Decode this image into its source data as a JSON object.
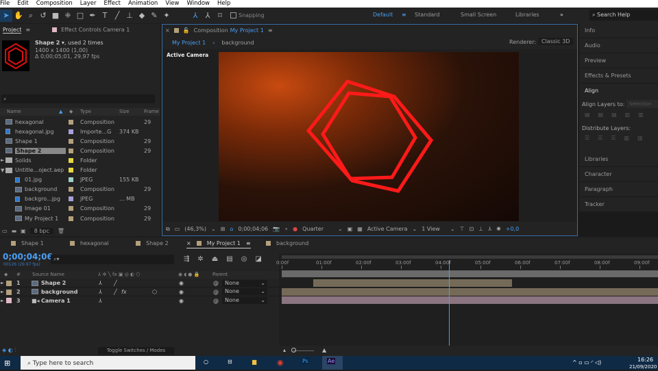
{
  "menu": [
    "File",
    "Edit",
    "Composition",
    "Layer",
    "Effect",
    "Animation",
    "View",
    "Window",
    "Help"
  ],
  "toolbar": {
    "snapping": "Snapping",
    "workspaces": [
      "Default",
      "Standard",
      "Small Screen",
      "Libraries"
    ],
    "active_workspace": "Default",
    "search_help": "Search Help"
  },
  "project": {
    "tab": "Project",
    "effect_controls_tab": "Effect Controls Camera 1",
    "selected_name": "Shape 2",
    "used": ", used 2 times",
    "dims": "1400 x 1400 (1,00)",
    "duration": "Δ 0;00;05;01, 29,97 fps",
    "search_placeholder": "",
    "columns": [
      "Name",
      "Type",
      "Size",
      "Frame"
    ],
    "items": [
      {
        "name": "hexagonal",
        "type": "Composition",
        "size": "",
        "frame": "29",
        "color": "#b4a07c",
        "indent": 0,
        "kind": "comp"
      },
      {
        "name": "hexagonal.jpg",
        "type": "Importe...G",
        "size": "374 KB",
        "frame": "",
        "color": "#a8a0d8",
        "indent": 0,
        "kind": "img"
      },
      {
        "name": "Shape 1",
        "type": "Composition",
        "size": "",
        "frame": "29",
        "color": "#b4a07c",
        "indent": 0,
        "kind": "comp"
      },
      {
        "name": "Shape 2",
        "type": "Composition",
        "size": "",
        "frame": "29",
        "color": "#b4a07c",
        "indent": 0,
        "kind": "comp",
        "selected": true
      },
      {
        "name": "Solids",
        "type": "Folder",
        "size": "",
        "frame": "",
        "color": "#e8d840",
        "indent": 0,
        "kind": "folder",
        "arrow": "►"
      },
      {
        "name": "Untitle...oject.aep",
        "type": "Folder",
        "size": "",
        "frame": "",
        "color": "#e8d840",
        "indent": 0,
        "kind": "folder",
        "arrow": "▼"
      },
      {
        "name": "01.jpg",
        "type": "JPEG",
        "size": "155 KB",
        "frame": "",
        "color": "#a0d0c8",
        "indent": 1,
        "kind": "img"
      },
      {
        "name": "background",
        "type": "Composition",
        "size": "",
        "frame": "29",
        "color": "#b4a07c",
        "indent": 1,
        "kind": "comp"
      },
      {
        "name": "backgro...jpg",
        "type": "JPEG",
        "size": "... MB",
        "frame": "",
        "color": "#a8a0d8",
        "indent": 1,
        "kind": "img"
      },
      {
        "name": "Image 01",
        "type": "Composition",
        "size": "",
        "frame": "29",
        "color": "#b4a07c",
        "indent": 1,
        "kind": "comp"
      },
      {
        "name": "My Project 1",
        "type": "Composition",
        "size": "",
        "frame": "29",
        "color": "#b4a07c",
        "indent": 1,
        "kind": "comp"
      }
    ],
    "bpc": "8 bpc"
  },
  "composition": {
    "tab_prefix": "Composition",
    "tab_name": "My Project 1",
    "breadcrumbs": [
      "My Project 1",
      "background"
    ],
    "renderer_label": "Renderer:",
    "renderer": "Classic 3D",
    "view_label": "Active Camera",
    "footer": {
      "zoom": "(46,3%)",
      "time": "0;00;04;06",
      "resolution": "Quarter",
      "camera": "Active Camera",
      "views": "1 View",
      "exposure": "+0,0"
    }
  },
  "right_panel": {
    "items": [
      "Info",
      "Audio",
      "Preview",
      "Effects & Presets",
      "Align"
    ],
    "align_to_label": "Align Layers to:",
    "align_to_value": "Selection",
    "distribute_label": "Distribute Layers:",
    "lower_items": [
      "Libraries",
      "Character",
      "Paragraph",
      "Tracker"
    ]
  },
  "timeline": {
    "tabs": [
      "Shape 1",
      "hexagonal",
      "Shape 2",
      "My Project 1",
      "background"
    ],
    "active_tab": "My Project 1",
    "timecode": "0;00;04;06",
    "frames": "00126 (29.97 fps)",
    "columns": {
      "num": "#",
      "source": "Source Name",
      "parent": "Parent"
    },
    "ruler": [
      "0:00f",
      "01:00f",
      "02:00f",
      "03:00f",
      "04:00f",
      "05:00f",
      "06:00f",
      "07:00f",
      "08:00f",
      "09:00f"
    ],
    "playhead_seconds": 4.2,
    "layers": [
      {
        "num": "1",
        "name": "Shape 2",
        "parent": "None",
        "color": "#b4a07c",
        "start": 0.8,
        "end": 5.8,
        "bar": "#756a58"
      },
      {
        "num": "2",
        "name": "background",
        "parent": "None",
        "color": "#b4a07c",
        "start": 0,
        "end": 10,
        "bar": "#756a58",
        "fx": "fx"
      },
      {
        "num": "3",
        "name": "Camera 1",
        "parent": "None",
        "color": "#e0b8c8",
        "start": 0,
        "end": 10,
        "bar": "#8a7580"
      }
    ],
    "toggle": "Toggle Switches / Modes"
  },
  "taskbar": {
    "search_placeholder": "Type here to search",
    "time": "16:26",
    "date": "21/09/2020"
  },
  "colors": {
    "accent": "#4a9ff5",
    "hexagon": "#ff1a1a"
  }
}
